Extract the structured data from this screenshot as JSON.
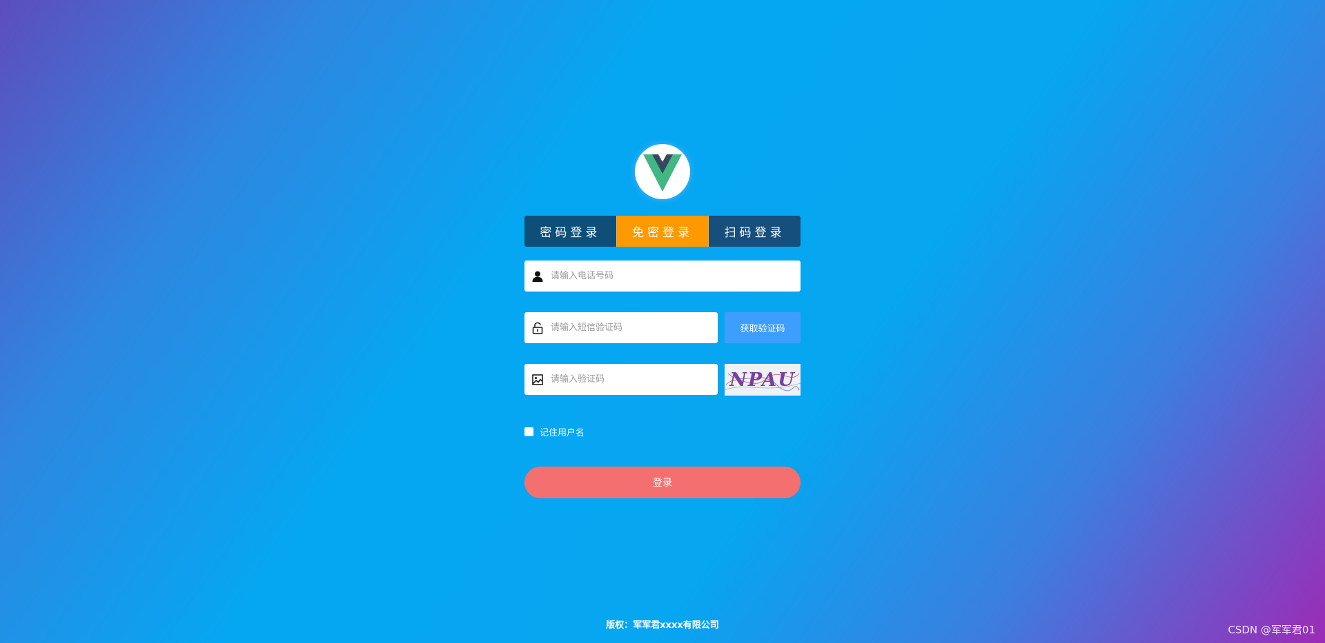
{
  "tabs": [
    {
      "label": "密码登录",
      "active": false
    },
    {
      "label": "免密登录",
      "active": true
    },
    {
      "label": "扫码登录",
      "active": false
    }
  ],
  "form": {
    "phone_placeholder": "请输入电话号码",
    "sms_placeholder": "请输入短信验证码",
    "sms_button": "获取验证码",
    "captcha_placeholder": "请输入验证码",
    "captcha_text": "NPAU",
    "remember_label": "记住用户名",
    "remember_checked": false,
    "login_button": "登录"
  },
  "footer": {
    "copyright": "版权：军军君xxxx有限公司",
    "watermark": "CSDN @军军君01"
  },
  "colors": {
    "tab_default": "#0d4f78",
    "tab_active": "#ff9900",
    "sms_button": "#3d9efd",
    "login_button": "#f46f6f"
  },
  "icons": [
    "vue-logo-icon",
    "user-icon",
    "lock-icon",
    "image-icon"
  ]
}
